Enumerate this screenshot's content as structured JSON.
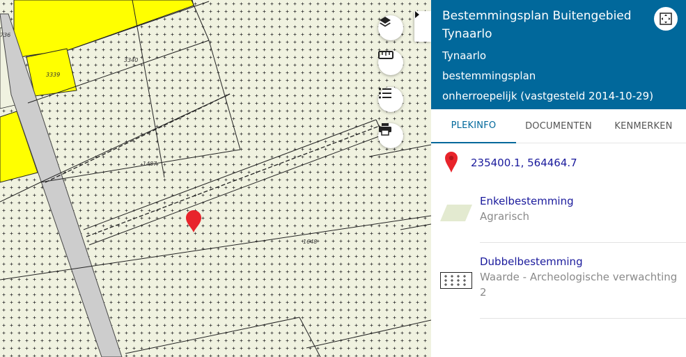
{
  "map": {
    "parcel_numbers": [
      "736",
      "3339",
      "3340",
      "1487",
      "1648"
    ],
    "colors": {
      "agrarisch": "#f0f2e0",
      "yellow_zone": "#ffff00",
      "road": "#cdcdcd",
      "marker": "#e8242b"
    },
    "controls": [
      "layers-icon",
      "ruler-icon",
      "list-icon",
      "printer-icon"
    ]
  },
  "panel": {
    "title": "Bestemmingsplan Buitengebied Tynaarlo",
    "municipality": "Tynaarlo",
    "plan_type": "bestemmingsplan",
    "status": "onherroepelijk (vastgesteld 2014-10-29)",
    "header_color": "#01689b",
    "tabs": [
      {
        "label": "PLEKINFO",
        "active": true
      },
      {
        "label": "DOCUMENTEN",
        "active": false
      },
      {
        "label": "KENMERKEN",
        "active": false
      }
    ],
    "coordinates": "235400.1, 564464.7",
    "entries": [
      {
        "title": "Enkelbestemming",
        "subtitle": "Agrarisch"
      },
      {
        "title": "Dubbelbestemming",
        "subtitle": "Waarde - Archeologische verwachting 2"
      }
    ]
  }
}
